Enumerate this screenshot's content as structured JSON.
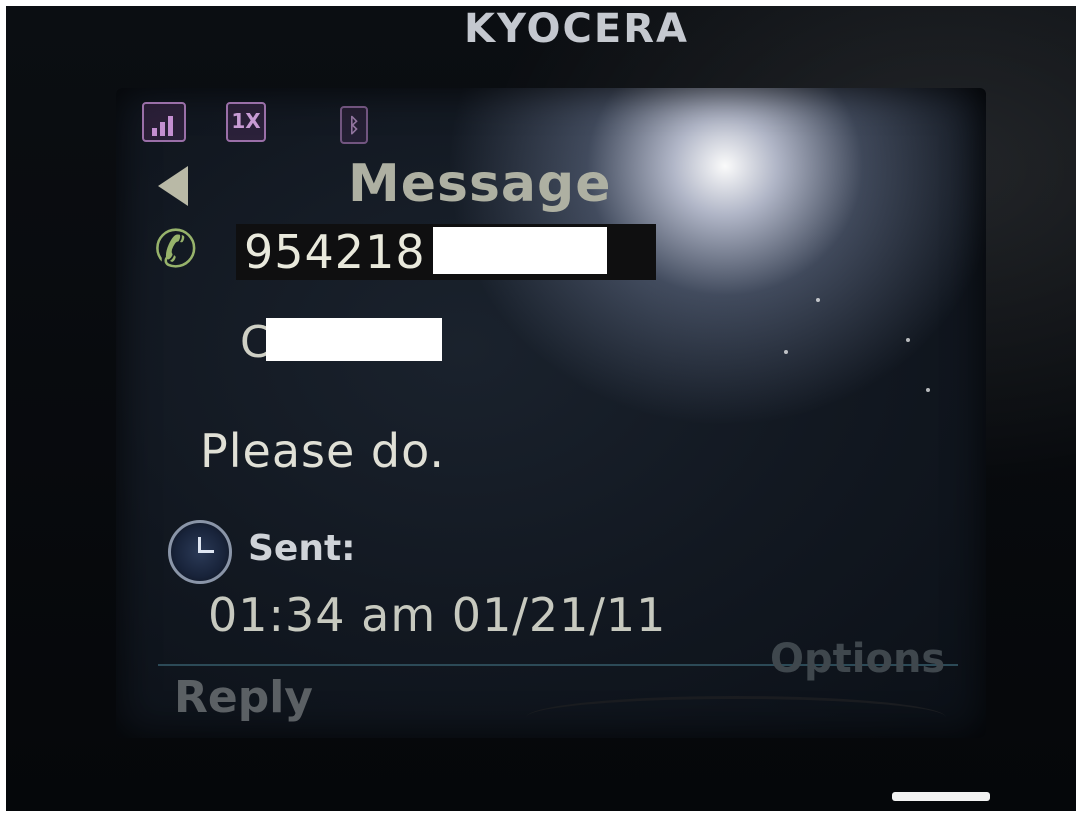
{
  "device": {
    "brand": "KYOCERA"
  },
  "status_bar": {
    "signal_icon": "signal-strength-icon",
    "network_label": "1X",
    "bluetooth_icon": "bluetooth-icon"
  },
  "header": {
    "back_icon": "back-arrow-icon",
    "title": "Message"
  },
  "message": {
    "contact_icon": "phone-icon",
    "number": "954218",
    "name_initial": "C",
    "body": "Please do.",
    "status_icon": "clock-icon",
    "status_label": "Sent:",
    "timestamp": "01:34 am 01/21/11"
  },
  "softkeys": {
    "left": "Reply",
    "right": "Options"
  },
  "colors": {
    "screen_bg": "#121821",
    "text": "#e0e0d6",
    "status_icon_accent": "#c89bd4",
    "phone_icon": "#97b36b"
  }
}
